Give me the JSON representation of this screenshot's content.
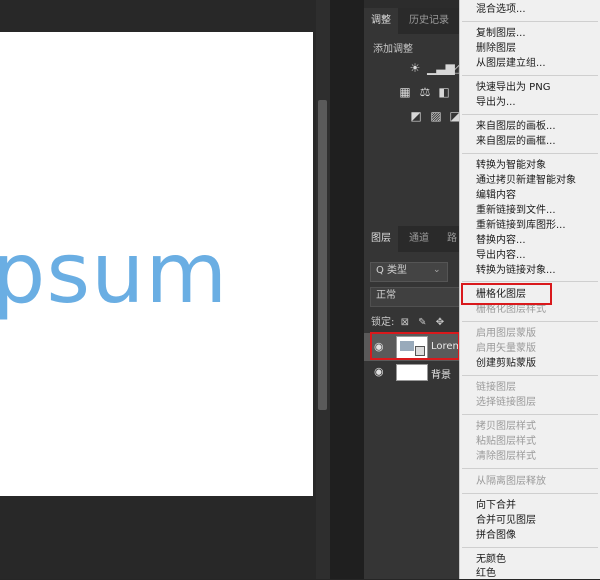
{
  "canvas": {
    "text": "psum",
    "text_color": "#6aaee3"
  },
  "adjustments": {
    "tabs": [
      "调整",
      "历史记录"
    ],
    "title": "添加调整"
  },
  "layers": {
    "tabs": [
      "图层",
      "通道",
      "路"
    ],
    "filter_label": "Q 类型",
    "blend_mode": "正常",
    "lock_label": "锁定:",
    "items": [
      {
        "name": "Lorem",
        "selected": true
      },
      {
        "name": "背景",
        "selected": false
      }
    ]
  },
  "context_menu": {
    "items": [
      {
        "label": "混合选项...",
        "disabled": false
      },
      {
        "label": "复制图层...",
        "disabled": false
      },
      {
        "label": "删除图层",
        "disabled": false
      },
      {
        "label": "从图层建立组...",
        "disabled": false
      },
      {
        "label": "快速导出为 PNG",
        "disabled": false
      },
      {
        "label": "导出为...",
        "disabled": false
      },
      {
        "label": "来自图层的画板...",
        "disabled": false
      },
      {
        "label": "来自图层的画框...",
        "disabled": false
      },
      {
        "label": "转换为智能对象",
        "disabled": false
      },
      {
        "label": "通过拷贝新建智能对象",
        "disabled": false
      },
      {
        "label": "编辑内容",
        "disabled": false
      },
      {
        "label": "重新链接到文件...",
        "disabled": false
      },
      {
        "label": "重新链接到库图形...",
        "disabled": false
      },
      {
        "label": "替换内容...",
        "disabled": false
      },
      {
        "label": "导出内容...",
        "disabled": false
      },
      {
        "label": "转换为链接对象...",
        "disabled": false
      },
      {
        "label": "栅格化图层",
        "disabled": false,
        "highlighted": true
      },
      {
        "label": "栅格化图层样式",
        "disabled": true
      },
      {
        "label": "启用图层蒙版",
        "disabled": true
      },
      {
        "label": "启用矢量蒙版",
        "disabled": true
      },
      {
        "label": "创建剪贴蒙版",
        "disabled": false
      },
      {
        "label": "链接图层",
        "disabled": true
      },
      {
        "label": "选择链接图层",
        "disabled": true
      },
      {
        "label": "拷贝图层样式",
        "disabled": true
      },
      {
        "label": "粘贴图层样式",
        "disabled": true
      },
      {
        "label": "清除图层样式",
        "disabled": true
      },
      {
        "label": "从隔离图层释放",
        "disabled": true
      },
      {
        "label": "向下合并",
        "disabled": false
      },
      {
        "label": "合并可见图层",
        "disabled": false
      },
      {
        "label": "拼合图像",
        "disabled": false
      },
      {
        "label": "无颜色",
        "disabled": false
      },
      {
        "label": "红色",
        "disabled": false
      }
    ]
  }
}
